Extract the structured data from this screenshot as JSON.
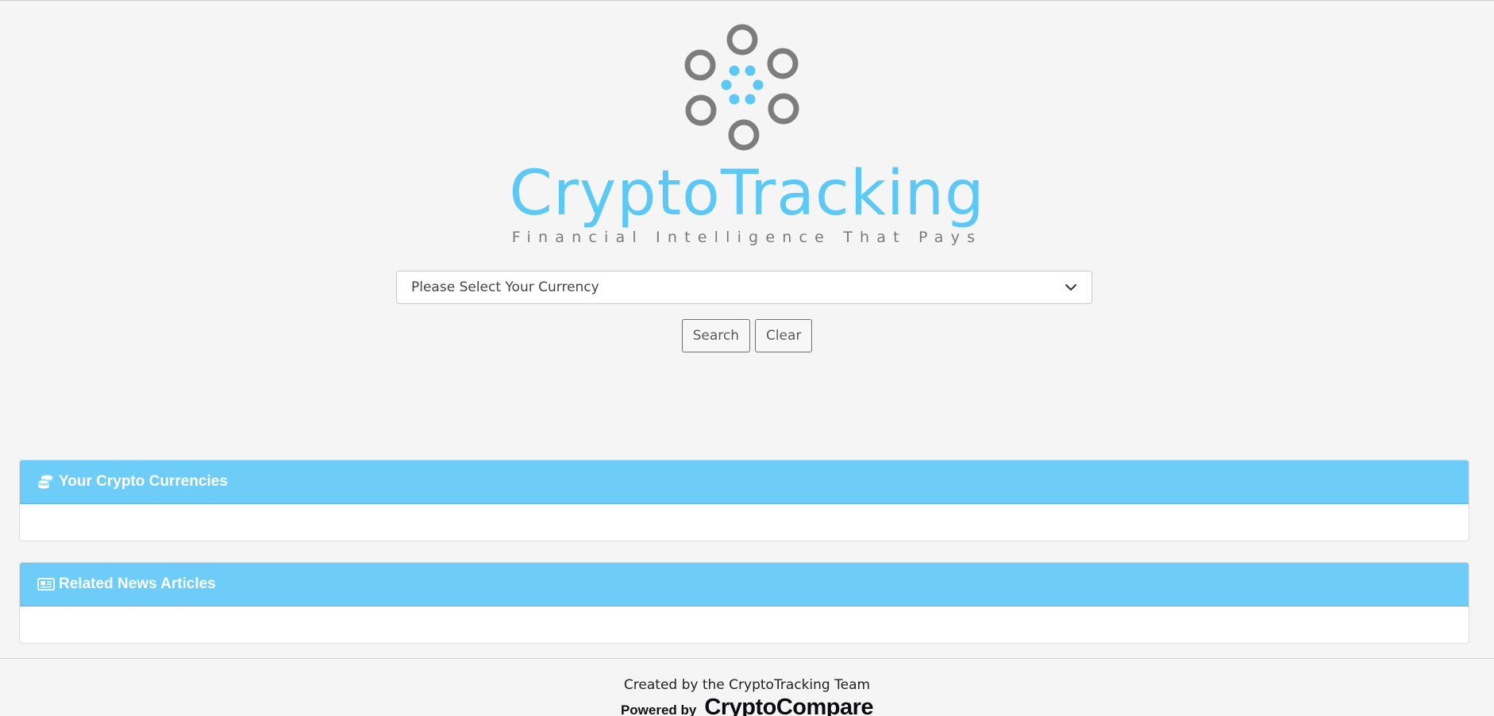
{
  "brand": {
    "name": "CryptoTracking",
    "tagline": "Financial Intelligence That Pays",
    "logo_icon": "crypto-ring-logo",
    "accent_color": "#5bc8f5",
    "ring_color": "#7d7d7d"
  },
  "search": {
    "currency_select_value": "Please Select Your Currency",
    "search_label": "Search",
    "clear_label": "Clear"
  },
  "panels": {
    "currencies": {
      "title": "Your Crypto Currencies",
      "icon": "coins-icon"
    },
    "news": {
      "title": "Related News Articles",
      "icon": "newspaper-icon"
    },
    "header_color": "#6ecdf8"
  },
  "footer": {
    "credit": "Created by the CryptoTracking Team",
    "powered_by_label": "Powered by",
    "powered_by_brand": "CryptoCompare"
  }
}
